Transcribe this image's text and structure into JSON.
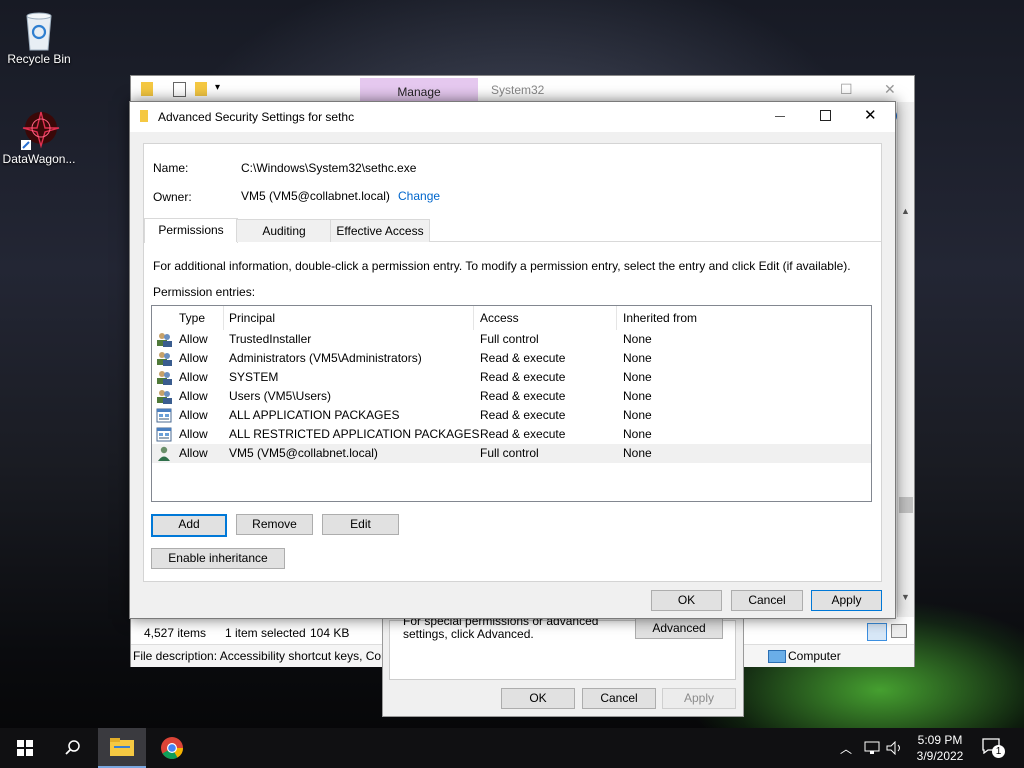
{
  "desktop": {
    "icons": [
      {
        "label": "Recycle Bin",
        "icon": "recycle-bin-icon"
      },
      {
        "label": "DataWagon...",
        "icon": "datawagon-icon"
      }
    ]
  },
  "explorer": {
    "ribbon_tab": "Manage",
    "title": "System32",
    "status": {
      "count": "4,527 items",
      "selection": "1 item selected",
      "size": "104 KB"
    },
    "description": "File description: Accessibility shortcut keys, Cor",
    "location": "Computer"
  },
  "properties_dialog": {
    "hint": "For special permissions or advanced settings, click Advanced.",
    "advanced_label": "Advanced",
    "ok_label": "OK",
    "cancel_label": "Cancel",
    "apply_label": "Apply"
  },
  "advanced_security": {
    "title": "Advanced Security Settings for sethc",
    "name_label": "Name:",
    "name_value": "C:\\Windows\\System32\\sethc.exe",
    "owner_label": "Owner:",
    "owner_value": "VM5 (VM5@collabnet.local)",
    "change_link": "Change",
    "tabs": [
      "Permissions",
      "Auditing",
      "Effective Access"
    ],
    "active_tab": "Permissions",
    "info": "For additional information, double-click a permission entry. To modify a permission entry, select the entry and click Edit (if available).",
    "entries_label": "Permission entries:",
    "columns": [
      "Type",
      "Principal",
      "Access",
      "Inherited from"
    ],
    "entries": [
      {
        "type": "Allow",
        "principal": "TrustedInstaller",
        "access": "Full control",
        "inherited": "None",
        "icon": "users-group-icon"
      },
      {
        "type": "Allow",
        "principal": "Administrators (VM5\\Administrators)",
        "access": "Read & execute",
        "inherited": "None",
        "icon": "users-group-icon"
      },
      {
        "type": "Allow",
        "principal": "SYSTEM",
        "access": "Read & execute",
        "inherited": "None",
        "icon": "users-group-icon"
      },
      {
        "type": "Allow",
        "principal": "Users (VM5\\Users)",
        "access": "Read & execute",
        "inherited": "None",
        "icon": "users-group-icon"
      },
      {
        "type": "Allow",
        "principal": "ALL APPLICATION PACKAGES",
        "access": "Read & execute",
        "inherited": "None",
        "icon": "app-packages-icon"
      },
      {
        "type": "Allow",
        "principal": "ALL RESTRICTED APPLICATION PACKAGES",
        "access": "Read & execute",
        "inherited": "None",
        "icon": "app-packages-icon"
      },
      {
        "type": "Allow",
        "principal": "VM5 (VM5@collabnet.local)",
        "access": "Full control",
        "inherited": "None",
        "icon": "user-icon"
      }
    ],
    "buttons": {
      "add": "Add",
      "remove": "Remove",
      "edit": "Edit",
      "enable_inheritance": "Enable inheritance"
    },
    "footer": {
      "ok": "OK",
      "cancel": "Cancel",
      "apply": "Apply"
    }
  },
  "taskbar": {
    "time": "5:09 PM",
    "date": "3/9/2022",
    "notification_count": "1"
  },
  "colors": {
    "accent": "#0078d7",
    "link": "#0066cc",
    "manage_tab": "#e6c9f0"
  }
}
